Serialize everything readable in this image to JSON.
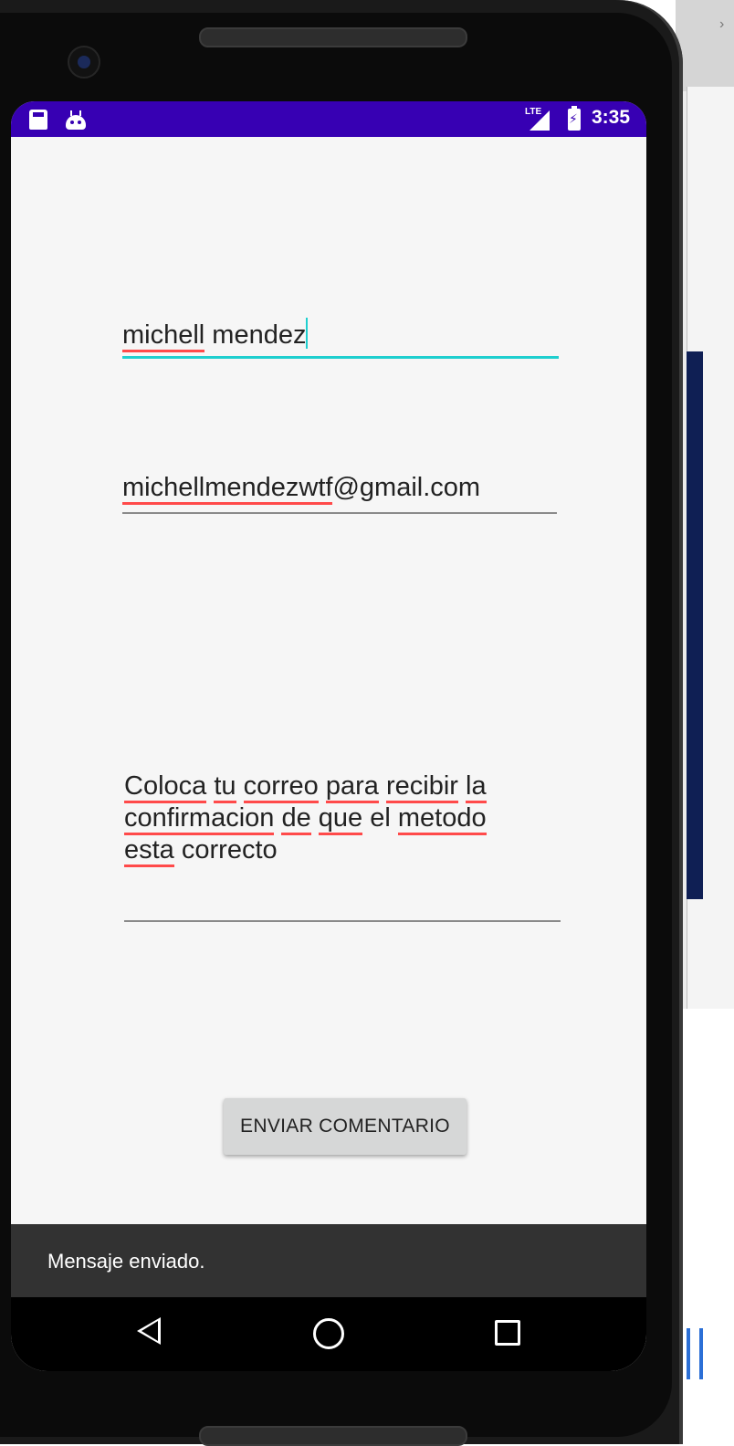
{
  "status_bar": {
    "network_label": "LTE",
    "time": "3:35"
  },
  "form": {
    "name_value_words": [
      "michell",
      " mendez"
    ],
    "email_value_parts": [
      "michellmendezwtf",
      "@gmail.com"
    ],
    "message_lines": [
      [
        "Coloca",
        " ",
        "tu",
        " ",
        "correo",
        " ",
        "para",
        " ",
        "recibir",
        " ",
        "la"
      ],
      [
        "confirmacion",
        " ",
        "de",
        " ",
        "que",
        " el ",
        "metodo"
      ],
      [
        "esta",
        " correcto"
      ]
    ],
    "submit_label": "ENVIAR COMENTARIO"
  },
  "snackbar": {
    "message": "Mensaje enviado."
  },
  "colors": {
    "status_bar": "#3700b3",
    "accent": "#1fcfcf",
    "spellcheck": "#ff4a4a",
    "screen_bg": "#f6f6f6"
  },
  "icons": [
    "sd-card-icon",
    "android-debug-icon",
    "signal-icon",
    "battery-charging-icon",
    "back-icon",
    "home-icon",
    "recents-icon"
  ]
}
